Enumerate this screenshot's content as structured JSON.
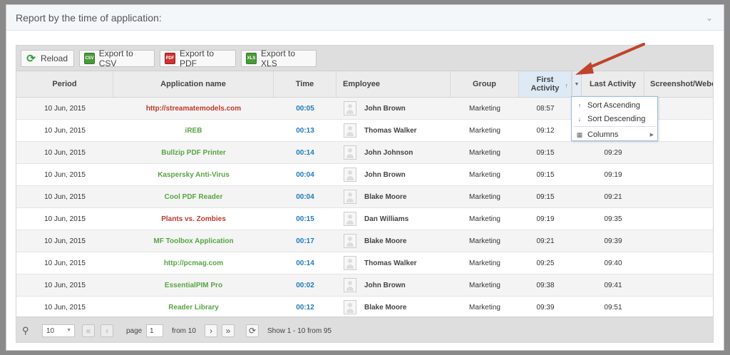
{
  "panel": {
    "title": "Report by the time of application:",
    "collapse_icon": "chevron-down-icon"
  },
  "toolbar": {
    "reload_label": "Reload",
    "csv_label": "Export to CSV",
    "pdf_label": "Export to PDF",
    "xls_label": "Export to XLS",
    "csv_icon_text": "CSV",
    "pdf_icon_text": "PDF",
    "xls_icon_text": "XLS"
  },
  "columns": {
    "period": "Period",
    "app": "Application name",
    "time": "Time",
    "employee": "Employee",
    "group": "Group",
    "first_activity": "First Activity",
    "last_activity": "Last Activity",
    "screenshot": "Screenshot/Webc"
  },
  "colors": {
    "app_red": "#c0392b",
    "app_green": "#58a445",
    "time_blue": "#1f7ab8",
    "accent": "#99bce8",
    "arrow": "#c0432e"
  },
  "rows": [
    {
      "period": "10 Jun, 2015",
      "app": "http://streamatemodels.com",
      "app_color": "#c0392b",
      "time": "00:05",
      "employee": "John Brown",
      "group": "Marketing",
      "first": "08:57",
      "last": ""
    },
    {
      "period": "10 Jun, 2015",
      "app": "iREB",
      "app_color": "#58a445",
      "time": "00:13",
      "employee": "Thomas Walker",
      "group": "Marketing",
      "first": "09:12",
      "last": ""
    },
    {
      "period": "10 Jun, 2015",
      "app": "Bullzip PDF Printer",
      "app_color": "#58a445",
      "time": "00:14",
      "employee": "John Johnson",
      "group": "Marketing",
      "first": "09:15",
      "last": "09:29"
    },
    {
      "period": "10 Jun, 2015",
      "app": "Kaspersky Anti-Virus",
      "app_color": "#58a445",
      "time": "00:04",
      "employee": "John Brown",
      "group": "Marketing",
      "first": "09:15",
      "last": "09:19"
    },
    {
      "period": "10 Jun, 2015",
      "app": "Cool PDF Reader",
      "app_color": "#58a445",
      "time": "00:04",
      "employee": "Blake Moore",
      "group": "Marketing",
      "first": "09:15",
      "last": "09:21"
    },
    {
      "period": "10 Jun, 2015",
      "app": "Plants vs. Zombies",
      "app_color": "#c0392b",
      "time": "00:15",
      "employee": "Dan Williams",
      "group": "Marketing",
      "first": "09:19",
      "last": "09:35"
    },
    {
      "period": "10 Jun, 2015",
      "app": "MF Toolbox Application",
      "app_color": "#58a445",
      "time": "00:17",
      "employee": "Blake Moore",
      "group": "Marketing",
      "first": "09:21",
      "last": "09:39"
    },
    {
      "period": "10 Jun, 2015",
      "app": "http://pcmag.com",
      "app_color": "#58a445",
      "time": "00:14",
      "employee": "Thomas Walker",
      "group": "Marketing",
      "first": "09:25",
      "last": "09:40"
    },
    {
      "period": "10 Jun, 2015",
      "app": "EssentialPIM Pro",
      "app_color": "#58a445",
      "time": "00:02",
      "employee": "John Brown",
      "group": "Marketing",
      "first": "09:38",
      "last": "09:41"
    },
    {
      "period": "10 Jun, 2015",
      "app": "Reader Library",
      "app_color": "#58a445",
      "time": "00:12",
      "employee": "Blake Moore",
      "group": "Marketing",
      "first": "09:39",
      "last": "09:51"
    }
  ],
  "column_menu": {
    "sort_asc": "Sort Ascending",
    "sort_desc": "Sort Descending",
    "columns": "Columns"
  },
  "pager": {
    "page_size": "10",
    "page_label": "page",
    "page_value": "1",
    "from_label": "from 10",
    "status": "Show 1 - 10 from 95"
  }
}
